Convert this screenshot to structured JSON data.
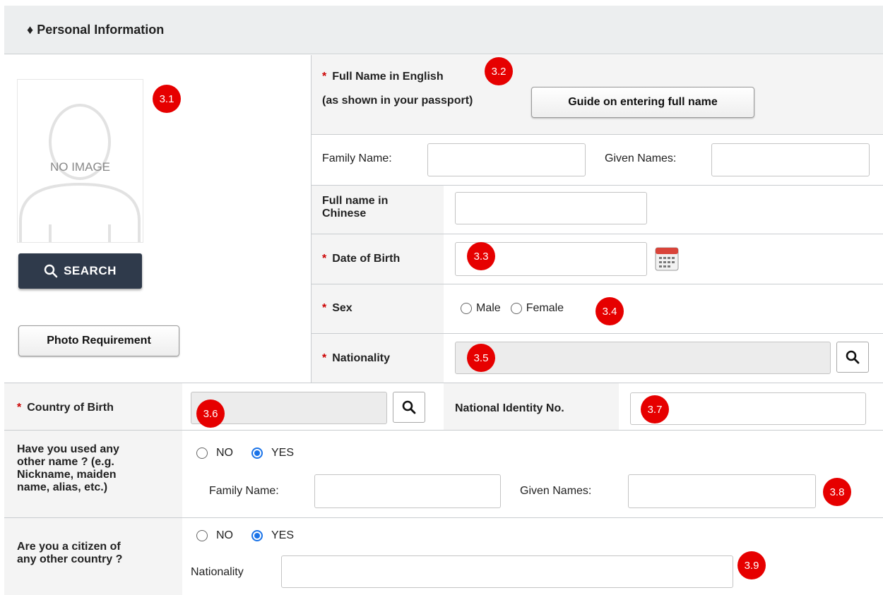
{
  "section": {
    "title": "Personal Information",
    "bullet": "♦"
  },
  "photo": {
    "placeholder": "NO IMAGE",
    "search_label": "SEARCH",
    "requirement_label": "Photo Requirement"
  },
  "full_name_en": {
    "label": "Full Name in English",
    "sublabel": "(as shown in your passport)",
    "guide_button": "Guide on entering full name",
    "family_label": "Family Name:",
    "given_label": "Given Names:",
    "family_value": "",
    "given_value": ""
  },
  "full_name_cn": {
    "label_line1": "Full name in",
    "label_line2": "Chinese",
    "value": ""
  },
  "dob": {
    "label": "Date of Birth",
    "value": ""
  },
  "sex": {
    "label": "Sex",
    "options": [
      "Male",
      "Female"
    ],
    "selected": null
  },
  "nationality": {
    "label": "Nationality",
    "value": ""
  },
  "country_of_birth": {
    "label": "Country of Birth",
    "value": ""
  },
  "national_id": {
    "label": "National Identity No.",
    "value": ""
  },
  "other_name": {
    "question_lines": [
      "Have you used any",
      "other name ? (e.g.",
      "Nickname, maiden",
      "name, alias, etc.)"
    ],
    "options": [
      "NO",
      "YES"
    ],
    "selected": "YES",
    "family_label": "Family Name:",
    "given_label": "Given Names:"
  },
  "other_citizen": {
    "question_lines": [
      "Are you a citizen of",
      "any other country ?"
    ],
    "options": [
      "NO",
      "YES"
    ],
    "selected": "YES",
    "nationality_label": "Nationality"
  },
  "annotations": [
    "3.1",
    "3.2",
    "3.3",
    "3.4",
    "3.5",
    "3.6",
    "3.7",
    "3.8",
    "3.9"
  ],
  "colors": {
    "badge": "#e60000",
    "header_bg": "#eceeef",
    "label_bg": "#f4f4f4",
    "search_btn": "#2f3a4b",
    "radio_selected": "#1a73e8",
    "required_star": "#cc0000"
  }
}
